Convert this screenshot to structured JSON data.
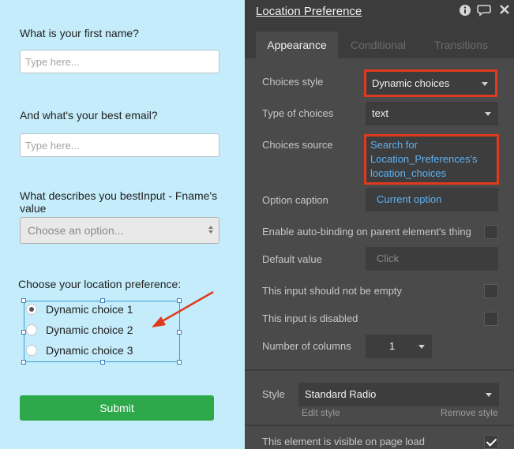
{
  "canvas": {
    "first_name_label": "What is your first name?",
    "first_name_placeholder": "Type here...",
    "email_label": "And what's your best email?",
    "email_placeholder": "Type here...",
    "describes_label": "What describes you bestInput - Fname's value",
    "dropdown_placeholder": "Choose an option...",
    "location_label": "Choose your location preference:",
    "radio_options": [
      "Dynamic choice 1",
      "Dynamic choice 2",
      "Dynamic choice 3"
    ],
    "selected_radio": 0,
    "submit_label": "Submit",
    "submit_color": "#2da84a"
  },
  "panel": {
    "title": "Location Preference",
    "icons": [
      "info-icon",
      "comment-icon",
      "close-icon"
    ],
    "tabs": [
      {
        "label": "Appearance",
        "active": true
      },
      {
        "label": "Conditional",
        "active": false
      },
      {
        "label": "Transitions",
        "active": false
      }
    ],
    "choices_style_label": "Choices style",
    "choices_style_value": "Dynamic choices",
    "type_of_choices_label": "Type of choices",
    "type_of_choices_value": "text",
    "choices_source_label": "Choices source",
    "choices_source_line1": "Search for",
    "choices_source_line2": "Location_Preferences's",
    "choices_source_line3": "location_choices",
    "option_caption_label": "Option caption",
    "option_caption_value": "Current option",
    "auto_binding_label": "Enable auto-binding on parent element's thing",
    "auto_binding_checked": false,
    "default_value_label": "Default value",
    "default_value_placeholder": "Click",
    "not_empty_label": "This input should not be empty",
    "not_empty_checked": false,
    "disabled_label": "This input is disabled",
    "disabled_checked": false,
    "columns_label": "Number of columns",
    "columns_value": "1",
    "style_label": "Style",
    "style_value": "Standard Radio",
    "edit_style_label": "Edit style",
    "remove_style_label": "Remove style",
    "visible_label": "This element is visible on page load",
    "visible_checked": true,
    "highlight_color": "#e03a1e",
    "link_color": "#5fb2f2"
  }
}
